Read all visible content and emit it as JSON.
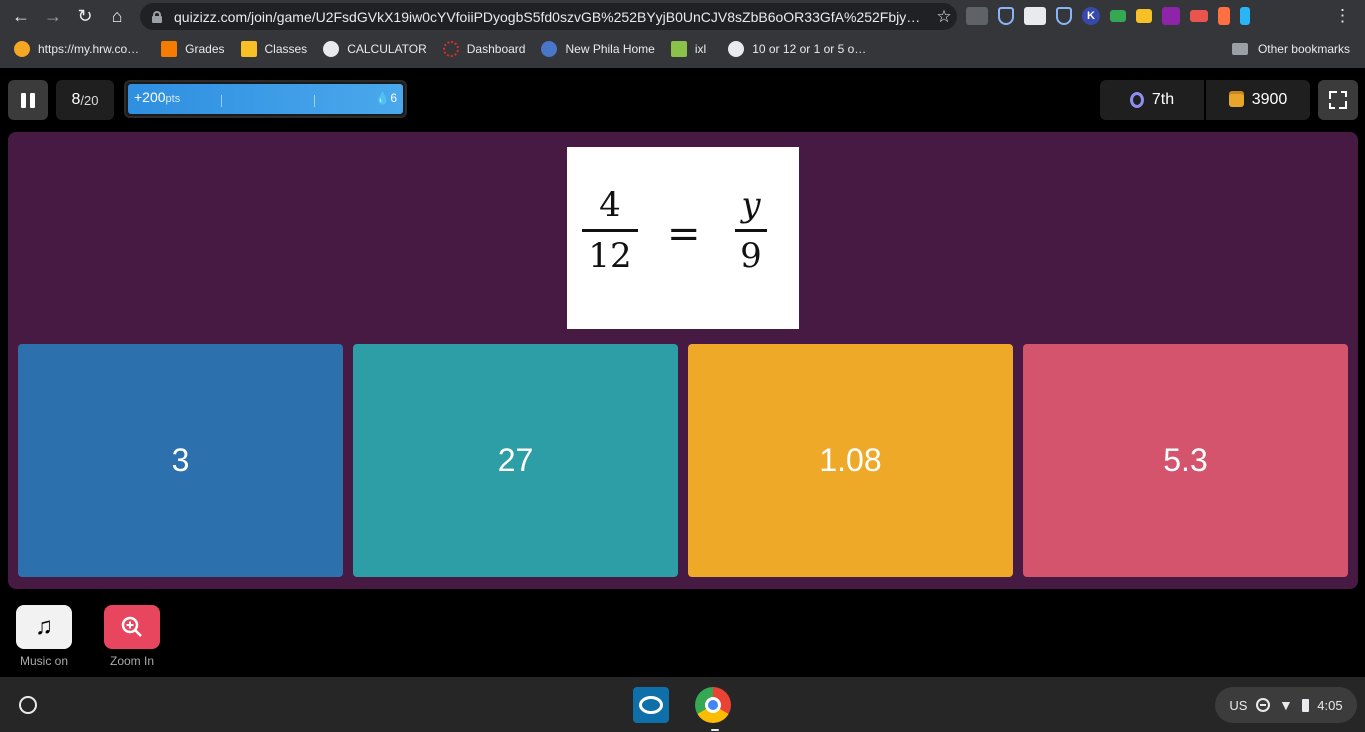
{
  "browser": {
    "url": "quizizz.com/join/game/U2FsdGVkX19iw0cYVfoiiPDyogbS5fd0szvGB%252BYyjB0UnCJV8sZbB6oOR33GfA%252Fbjy…",
    "bookmarks": [
      {
        "label": "https://my.hrw.co…",
        "color": "#f5a623"
      },
      {
        "label": "Grades",
        "color": "#f57c00"
      },
      {
        "label": "Classes",
        "color": "#f6c026"
      },
      {
        "label": "CALCULATOR",
        "color": "#e8eaed"
      },
      {
        "label": "Dashboard",
        "color": "#d93025"
      },
      {
        "label": "New Phila Home",
        "color": "#4a76c9"
      },
      {
        "label": "ixl",
        "color": "#8bc34a"
      },
      {
        "label": "10 or 12 or 1 or 5 o…",
        "color": "#e8eaed"
      }
    ],
    "other_bookmarks": "Other bookmarks"
  },
  "quiz": {
    "question_number": "8",
    "question_total": "/20",
    "points": "+200",
    "points_unit": "pts",
    "streak": "6",
    "rank": "7th",
    "score": "3900",
    "equation": {
      "num1": "4",
      "den1": "12",
      "equals": "=",
      "num2": "y",
      "den2": "9"
    },
    "answers": [
      {
        "label": "3",
        "color": "#2d70ae"
      },
      {
        "label": "27",
        "color": "#2d9da6"
      },
      {
        "label": "1.08",
        "color": "#efa929"
      },
      {
        "label": "5.3",
        "color": "#d5546d"
      }
    ],
    "music_label": "Music on",
    "zoom_label": "Zoom In"
  },
  "shelf": {
    "locale": "US",
    "time": "4:05"
  }
}
